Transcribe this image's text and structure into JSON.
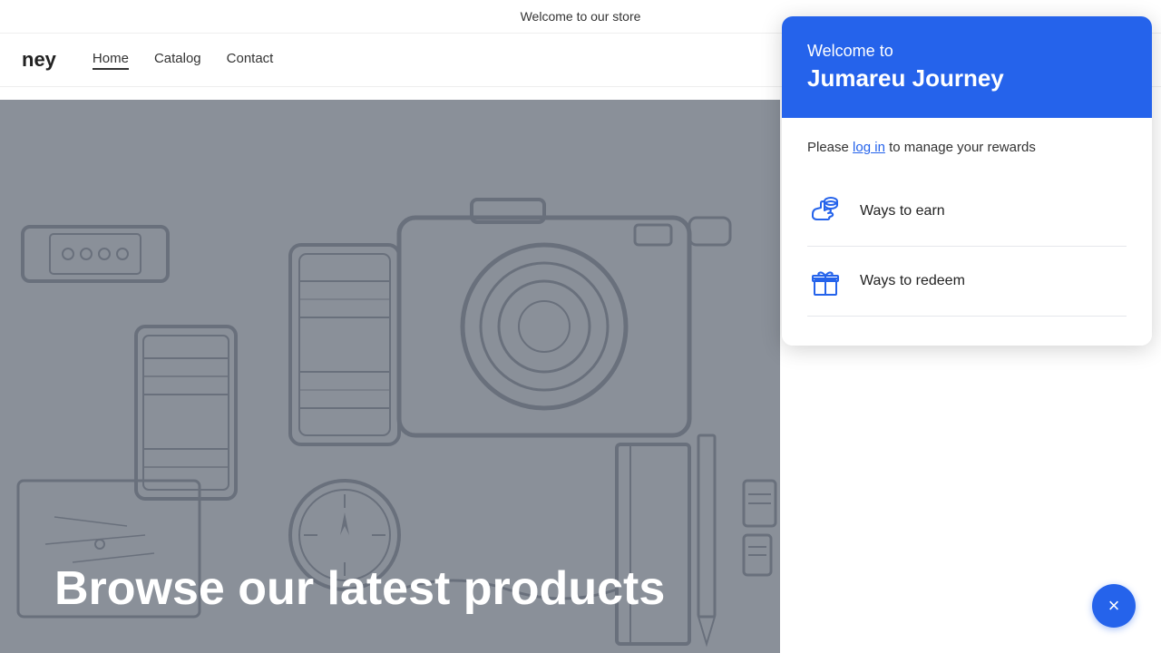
{
  "announcement": {
    "text": "Welcome to our store"
  },
  "header": {
    "logo": "ney",
    "nav": [
      {
        "label": "Home",
        "active": true
      },
      {
        "label": "Catalog",
        "active": false
      },
      {
        "label": "Contact",
        "active": false
      }
    ]
  },
  "hero": {
    "browse_text": "Browse our latest products"
  },
  "rewards_panel": {
    "welcome_line1": "Welcome to",
    "brand_name": "Jumareu Journey",
    "login_prompt_before": "Please ",
    "login_link": "log in",
    "login_prompt_after": " to manage your rewards",
    "items": [
      {
        "id": "earn",
        "label": "Ways to earn",
        "icon": "earn-icon"
      },
      {
        "id": "redeem",
        "label": "Ways to redeem",
        "icon": "redeem-icon"
      }
    ],
    "close_button_label": "×"
  }
}
